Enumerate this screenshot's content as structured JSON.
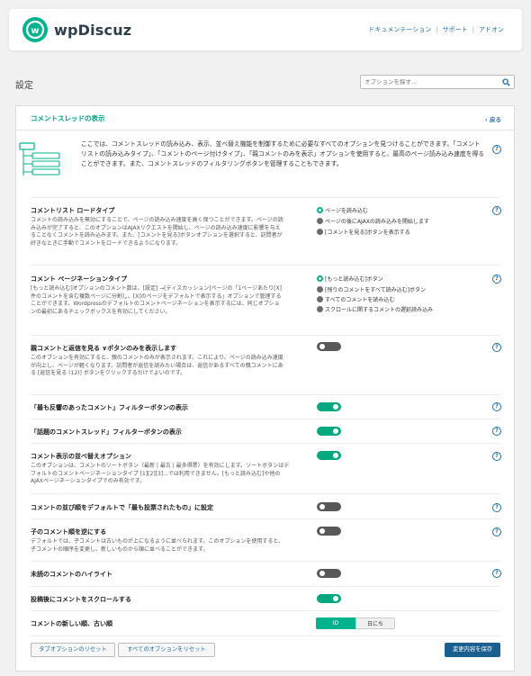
{
  "header": {
    "brand": "wpDiscuz",
    "links": [
      "ドキュメンテーション",
      "サポート",
      "アドオン"
    ]
  },
  "page": {
    "title": "設定",
    "search_placeholder": "オプションを探す..."
  },
  "panel": {
    "title": "コメントスレッドの表示",
    "back": "‹ 戻る",
    "intro": "ここでは、コメントスレッドの読み込み、表示、並べ替え機能を制御するために必要なすべてのオプションを見つけることができます。「コメントリストの読み込みタイプ」、「コメントのページ付けタイプ」、「親コメントのみを表示」オプションを使用すると、最高のページ読み込み速度を得ることができます。また、コメントスレッドのフィルタリングボタンを管理することもできます。"
  },
  "settings": {
    "load_type": {
      "title": "コメントリスト ロードタイプ",
      "desc": "コメントの読み込みを無効にすることで、ページの読み込み速度を高く保つことができます。ページの読み込みが完了すると、このオプションはAJAXリクエストを開始し、ページの読み込み速度に影響を与えることなくコメントを読み込みます。また、[コメントを見る]ボタンオプションを選択すると、訪問者が好きなときに手動でコメントをロードできるようになります。",
      "options": [
        "ページを読み込む",
        "ページの後にAJAXの読み込みを開始します",
        "[コメントを見る]ボタンを表示する"
      ],
      "selected": 0
    },
    "pagination": {
      "title": "コメント ページネーションタイプ",
      "desc": "[もっと読み込む]オプションのコメント数は、[設定] →[ディスカッション]ページの「1ページあたり[X]件のコメントを含む複数ページに分割し、[X]のページをデフォルトで表示する」オプションで管理することができます。Wordpressのデフォルトのコメントページネーションを表示するには、同じオプションの最初にあるチェックボックスを有効にしてください。",
      "options": [
        "[もっと読み込む]ボタン",
        "[残りのコメントをすべて読み込む]ボタン",
        "すべてのコメントを読み込む",
        "スクロールに関するコメントの遅延読み込み"
      ],
      "selected": 0
    },
    "parent_only": {
      "title": "親コメントと返信を見る ∨ボタンのみを表示します",
      "desc": "このオプションを有効にすると、親のコメントのみが表示されます。これにより、ページの読み込み速度が向上し、ページが軽くなります。訪問者が返信を読みたい場合は、返信があるすべての親コメントにある [返信を見る (12)] ボタンをクリックするだけでよいのです。",
      "enabled": false
    },
    "most_reacted": {
      "title": "「最も反響のあったコメント」フィルターボタンの表示",
      "enabled": true
    },
    "hottest": {
      "title": "「話題のコメントスレッド」フィルターボタンの表示",
      "enabled": true
    },
    "sorting": {
      "title": "コメント表示の並べ替えオプション",
      "desc": "このオプションは、コメントのソートボタン（最新 | 最古 | 最多得票）を有効にします。ソートボタンはデフォルトのコメントページネーションタイプ [1][2][3]...では利用できません。[もっと読み込む]や他のAJAXページネーションタイプでのみ有効です。",
      "enabled": true
    },
    "most_voted_default": {
      "title": "コメントの並び順をデフォルトで「最も投票されたもの」に設定",
      "enabled": false
    },
    "reverse_children": {
      "title": "子のコメント順を逆にする",
      "desc": "デフォルトでは、子コメントは古いものが上になるように並べられます。このオプションを使用すると、子コメントの順序を変更し、新しいものから順に並べることができます。",
      "enabled": false
    },
    "highlight_unread": {
      "title": "未読のコメントのハイライト",
      "enabled": false
    },
    "scroll_after_post": {
      "title": "投稿後にコメントをスクロールする",
      "enabled": true
    },
    "order": {
      "title": "コメントの新しい順、古い順",
      "options": [
        "ID",
        "日にち"
      ],
      "selected": 0
    }
  },
  "footer": {
    "reset_tab": "タブオプションのリセット",
    "reset_all": "すべてのオプションをリセット",
    "save": "変更内容を保存"
  },
  "colors": {
    "accent": "#00b38f",
    "link": "#1f6fa6",
    "save": "#1a5f90"
  },
  "help_icon": "?"
}
